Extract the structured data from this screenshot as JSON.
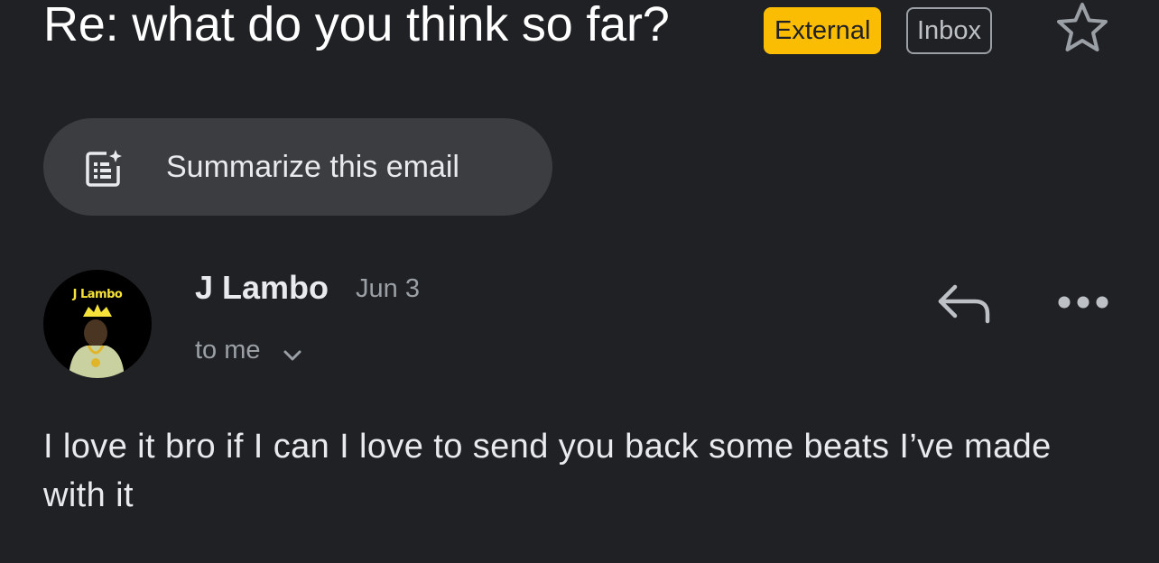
{
  "email": {
    "subject": "Re: what do you think so far?",
    "labels": {
      "external": "External",
      "inbox": "Inbox"
    },
    "summarize_label": "Summarize this email",
    "sender": {
      "name": "J Lambo",
      "avatar_text": "J Lambo",
      "date": "Jun 3",
      "recipient": "to me"
    },
    "body": "I love it bro if I can I love to send you back some beats I’ve made with it"
  },
  "icons": {
    "star": "star-outline-icon",
    "summarize": "summarize-sparkle-icon",
    "chevron": "chevron-down-icon",
    "reply": "reply-icon",
    "more": "more-horizontal-icon"
  },
  "colors": {
    "background": "#202124",
    "external_badge": "#fbbc04",
    "summarize_chip": "#3c3d40",
    "secondary_text": "#9aa0a6"
  }
}
